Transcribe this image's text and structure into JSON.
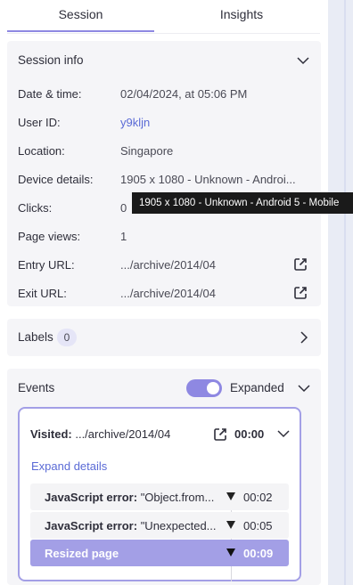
{
  "tabs": [
    {
      "label": "Session",
      "active": true
    },
    {
      "label": "Insights",
      "active": false
    }
  ],
  "session_info": {
    "title": "Session info",
    "rows": [
      {
        "key": "Date & time:",
        "value": "02/04/2024, at 05:06 PM"
      },
      {
        "key": "User ID:",
        "value": "y9kljn"
      },
      {
        "key": "Location:",
        "value": "Singapore"
      },
      {
        "key": "Device details:",
        "value": "1905 x 1080 - Unknown - Androi..."
      },
      {
        "key": "Clicks:",
        "value": "0"
      },
      {
        "key": "Page views:",
        "value": "1"
      },
      {
        "key": "Entry URL:",
        "value": ".../archive/2014/04"
      },
      {
        "key": "Exit URL:",
        "value": ".../archive/2014/04"
      }
    ],
    "tooltip": "1905 x 1080 - Unknown - Android 5 - Mobile"
  },
  "labels": {
    "title": "Labels",
    "count": "0"
  },
  "events": {
    "title": "Events",
    "toggle_label": "Expanded",
    "toggle_on": true,
    "visit": {
      "prefix": "Visited:",
      "url": ".../archive/2014/04",
      "time": "00:00",
      "expand_label": "Expand details",
      "items": [
        {
          "type": "JavaScript error:",
          "detail": "\"Object.from...",
          "time": "00:02"
        },
        {
          "type": "JavaScript error:",
          "detail": "\"Unexpected...",
          "time": "00:05"
        },
        {
          "type": "Resized page",
          "detail": "",
          "time": "00:09"
        }
      ]
    }
  },
  "colors": {
    "accent": "#8e88e2",
    "link": "#5b6bd6",
    "card_bg": "#f5f5f8"
  }
}
